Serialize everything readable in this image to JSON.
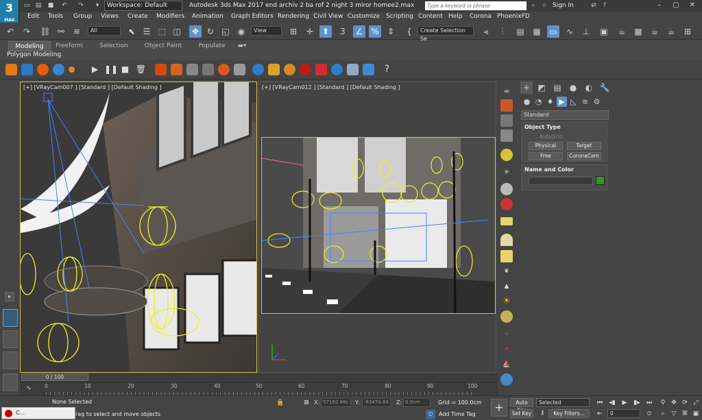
{
  "app": {
    "logo_text": "3",
    "logo_sub": "MAX",
    "workspace": "Workspace: Default",
    "title": "Autodesk 3ds Max 2017    end archiv 2 ba rof 2 night 3 miror homee2.max",
    "search_placeholder": "Type a keyword or phrase",
    "sign_in": "Sign In"
  },
  "menu": [
    "Edit",
    "Tools",
    "Group",
    "Views",
    "Create",
    "Modifiers",
    "Animation",
    "Graph Editors",
    "Rendering",
    "Civil View",
    "Customize",
    "Scripting",
    "Content",
    "Help",
    "Corona",
    "PhoenixFD"
  ],
  "toolbar": {
    "filter_select": "All",
    "ref_coord": "View",
    "selection_set": "Create Selection Se"
  },
  "ribbon": {
    "tabs": [
      "Modeling",
      "Freeform",
      "Selection",
      "Object Paint",
      "Populate"
    ],
    "active_tab": "Modeling",
    "sub_label": "Polygon Modeling"
  },
  "viewports": {
    "left_label": "[+] [VRayCam007 ] [Standard ] [Default Shading ]",
    "right_label": "[+] [VRayCam012 ] [Standard ] [Default Shading ]"
  },
  "command_panel": {
    "category": "Standard",
    "object_type": {
      "title": "Object Type",
      "autogrid": "AutoGrid",
      "buttons": [
        "Physical",
        "Target",
        "Free",
        "CoronaCam"
      ]
    },
    "name_color": {
      "title": "Name and Color",
      "color": "#2c9a1e"
    }
  },
  "timeline": {
    "frame": "0 / 100",
    "ticks": [
      "0",
      "10",
      "20",
      "30",
      "40",
      "50",
      "60",
      "70",
      "80",
      "90",
      "100"
    ]
  },
  "status": {
    "selection": "None Selected",
    "prompt": "rag to select and move objects",
    "x_label": "X:",
    "x_value": "57192.48c",
    "y_label": "Y:",
    "y_value": "-63474.88",
    "z_label": "Z:",
    "z_value": "0.0cm",
    "grid": "Grid = 100.0cm",
    "add_time_tag": "Add Time Tag",
    "auto_key": "Auto Key",
    "set_key": "Set Key",
    "key_mode": "Selected",
    "key_filters": "Key Filters...",
    "frame_field": "0",
    "taskbar_item": "C..."
  }
}
